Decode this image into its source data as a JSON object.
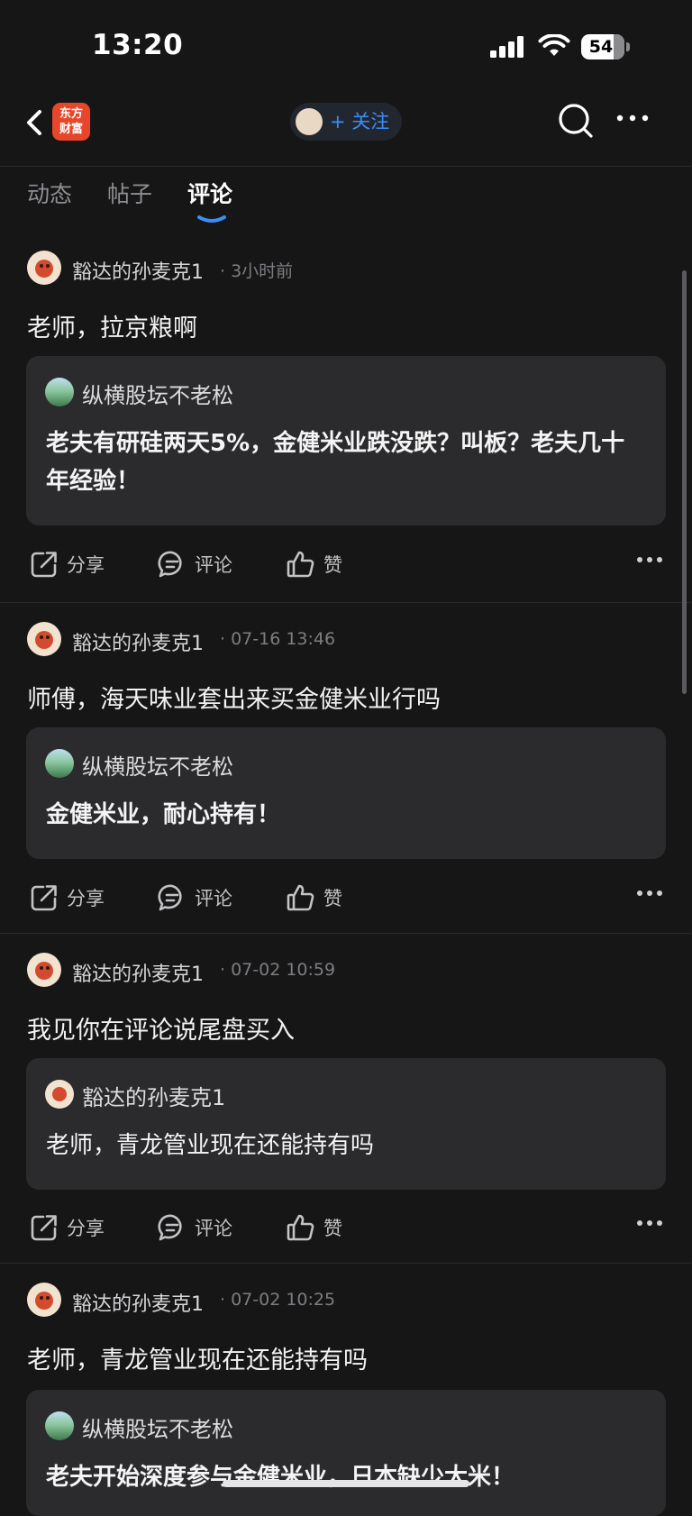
{
  "status_bar": {
    "time": "13:20",
    "battery": "54"
  },
  "nav": {
    "logo_text_1": "东方",
    "logo_text_2": "财富",
    "follow_label": "+ 关注"
  },
  "tabs": [
    {
      "label": "动态"
    },
    {
      "label": "帖子"
    },
    {
      "label": "评论"
    }
  ],
  "active_tab": "评论",
  "actions": {
    "share": "分享",
    "comment": "评论",
    "like": "赞"
  },
  "posts": [
    {
      "username": "豁达的孙麦克1",
      "time": "· 3小时前",
      "text": "老师，拉京粮啊",
      "quote": {
        "username": "纵横股坛不老松",
        "text": "老夫有研硅两天5%，金健米业跌没跌？叫板？老夫几十年经验！"
      }
    },
    {
      "username": "豁达的孙麦克1",
      "time": "· 07-16 13:46",
      "text": "师傅，海天味业套出来买金健米业行吗",
      "quote": {
        "username": "纵横股坛不老松",
        "text": "金健米业，耐心持有！"
      }
    },
    {
      "username": "豁达的孙麦克1",
      "time": "· 07-02 10:59",
      "text": "我见你在评论说尾盘买入",
      "quote": {
        "username": "豁达的孙麦克1",
        "text": "老师，青龙管业现在还能持有吗"
      }
    },
    {
      "username": "豁达的孙麦克1",
      "time": "· 07-02 10:25",
      "text": "老师，青龙管业现在还能持有吗",
      "quote": {
        "username": "纵横股坛不老松",
        "text": "老夫开始深度参与金健米业，日本缺少大米！"
      }
    }
  ],
  "colors": {
    "background": "#161617",
    "accent": "#3a8ef6",
    "brand": "#e8462a"
  }
}
